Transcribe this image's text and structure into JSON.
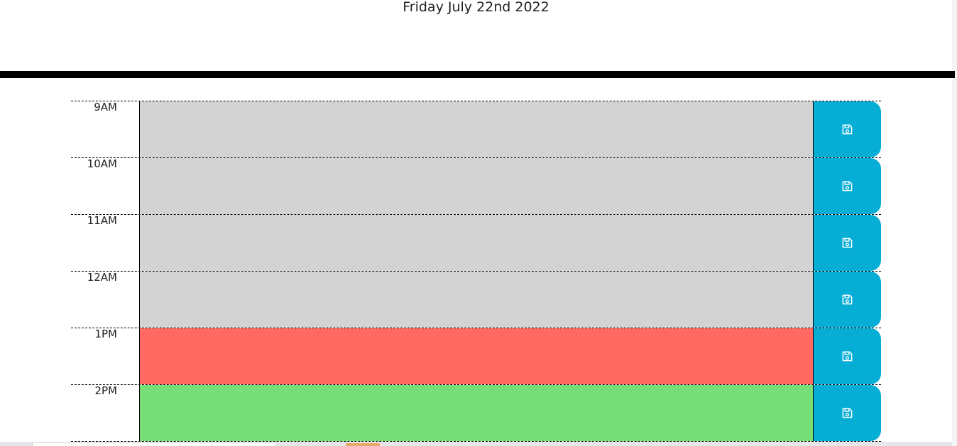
{
  "header": {
    "current_day": "Friday July 22nd 2022"
  },
  "schedule": {
    "blocks": [
      {
        "hour": "9AM",
        "status": "past",
        "description": "",
        "save_icon": "floppy-disk-icon"
      },
      {
        "hour": "10AM",
        "status": "past",
        "description": "",
        "save_icon": "floppy-disk-icon"
      },
      {
        "hour": "11AM",
        "status": "past",
        "description": "",
        "save_icon": "floppy-disk-icon"
      },
      {
        "hour": "12AM",
        "status": "past",
        "description": "",
        "save_icon": "floppy-disk-icon"
      },
      {
        "hour": "1PM",
        "status": "present",
        "description": "",
        "save_icon": "floppy-disk-icon"
      },
      {
        "hour": "2PM",
        "status": "future",
        "description": "",
        "save_icon": "floppy-disk-icon"
      }
    ]
  },
  "colors": {
    "past": "#d3d3d3",
    "present": "#ff6961",
    "future": "#77dd77",
    "save_button": "#06aed5",
    "header_rule": "#000000"
  }
}
